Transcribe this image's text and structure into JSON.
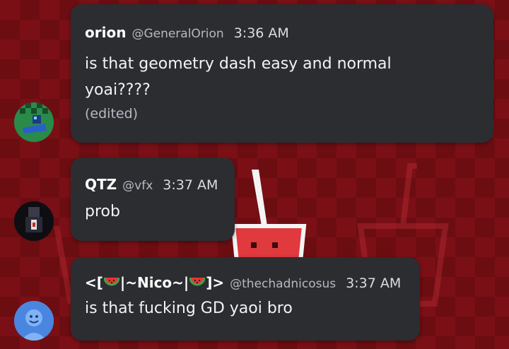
{
  "messages": [
    {
      "author": "orion",
      "handle": "@GeneralOrion",
      "time": "3:36 AM",
      "lines": [
        "is that geometry dash easy and normal",
        "yoai????"
      ],
      "edited": "(edited)"
    },
    {
      "author": "QTZ",
      "handle": "@vfx",
      "time": "3:37 AM",
      "lines": [
        "prob"
      ]
    },
    {
      "author_parts": [
        "<[",
        "|~Nico~|",
        "]>"
      ],
      "author_emoji": "watermelon-emoji",
      "handle": "@thechadnicosus",
      "time": "3:37 AM",
      "lines": [
        "is that fucking GD yaoi bro"
      ]
    }
  ],
  "colors": {
    "bubble": "#2b2d31",
    "background": "#7a1016",
    "text": "#f2f3f5",
    "muted": "#b5bac1"
  }
}
